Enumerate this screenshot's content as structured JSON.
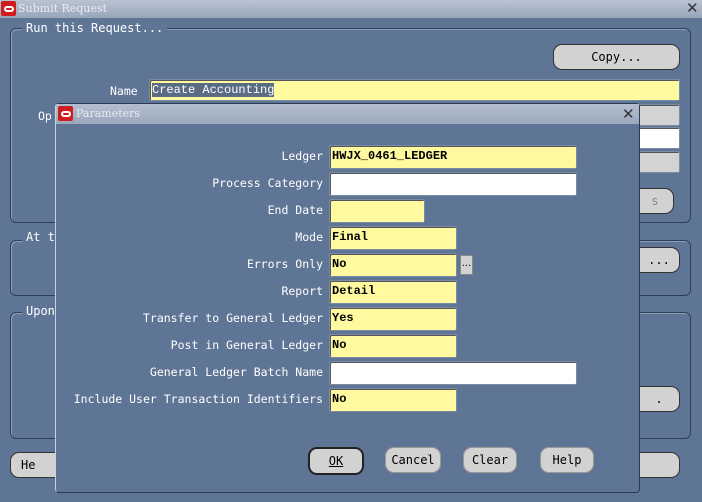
{
  "window": {
    "title": "Submit Request"
  },
  "main": {
    "group_run": "Run this Request...",
    "copy_button": "Copy...",
    "name_label": "Name",
    "name_value": "Create Accounting",
    "operating_label_partial": "Op",
    "group_at": "At t",
    "group_upon": "Upon",
    "button_s_partial": "s",
    "button_ellipsis_partial": "...",
    "button_dot_partial": ".",
    "bottom_left_button_partial": "He"
  },
  "dialog": {
    "title": "Parameters",
    "fields": [
      {
        "label": "Ledger",
        "value": "HWJX_0461_LEDGER",
        "style": "yellow"
      },
      {
        "label": "Process Category",
        "value": "",
        "style": "white"
      },
      {
        "label": "End Date",
        "value": "",
        "style": "yellow"
      },
      {
        "label": "Mode",
        "value": "Final",
        "style": "yellow"
      },
      {
        "label": "Errors Only",
        "value": "No",
        "style": "yellow"
      },
      {
        "label": "Report",
        "value": "Detail",
        "style": "yellow"
      },
      {
        "label": "Transfer to General Ledger",
        "value": "Yes",
        "style": "yellow"
      },
      {
        "label": "Post in General Ledger",
        "value": "No",
        "style": "yellow"
      },
      {
        "label": "General Ledger Batch Name",
        "value": "",
        "style": "white"
      },
      {
        "label": "Include User Transaction Identifiers",
        "value": "No",
        "style": "yellow"
      }
    ],
    "lov_button": "...",
    "buttons": {
      "ok": "OK",
      "cancel": "Cancel",
      "clear": "Clear",
      "help": "Help"
    }
  }
}
